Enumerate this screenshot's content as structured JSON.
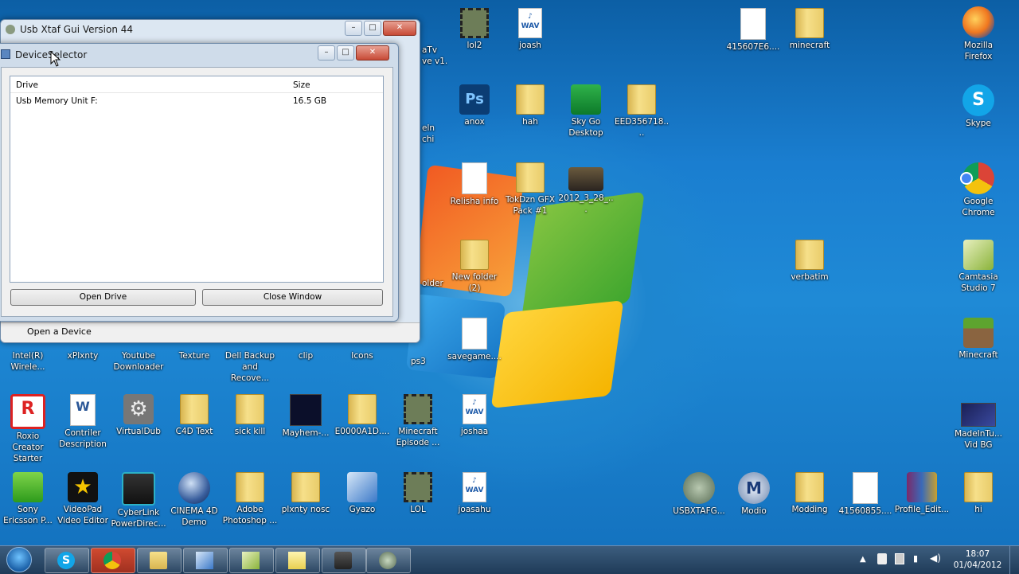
{
  "app_window": {
    "title": "Usb Xtaf Gui Version 44",
    "status": "Open a Device"
  },
  "dialog": {
    "title": "DeviceSelector",
    "columns": [
      "Drive",
      "Size"
    ],
    "rows": [
      {
        "drive": "Usb Memory Unit F:",
        "size": "16.5 GB"
      }
    ],
    "open_button": "Open Drive",
    "close_button": "Close Window"
  },
  "bg_partial_labels": {
    "a": "aTv",
    "b": "ve v1.",
    "c": "eln",
    "d": "chi",
    "e": "older",
    "f": "ps3"
  },
  "desktop_icons": [
    {
      "label": "lol2",
      "icon": "film-icon"
    },
    {
      "label": "joash",
      "icon": "wav-icon"
    },
    {
      "label": "415607E6....",
      "icon": "document-icon"
    },
    {
      "label": "minecraft",
      "icon": "folder-icon"
    },
    {
      "label": "Mozilla Firefox",
      "icon": "firefox-icon"
    },
    {
      "label": "anox",
      "icon": "psd-icon"
    },
    {
      "label": "hah",
      "icon": "folder-icon"
    },
    {
      "label": "Sky Go Desktop",
      "icon": "skygo-icon"
    },
    {
      "label": "EED356718....",
      "icon": "folder-icon"
    },
    {
      "label": "Skype",
      "icon": "skype-icon"
    },
    {
      "label": "Relisha info",
      "icon": "document-icon"
    },
    {
      "label": "TokDzn GFX Pack #1",
      "icon": "folder-icon"
    },
    {
      "label": "2012_3_28_...",
      "icon": "video-icon"
    },
    {
      "label": "Google Chrome",
      "icon": "chrome-icon"
    },
    {
      "label": "New folder (2)",
      "icon": "folder-icon"
    },
    {
      "label": "verbatim",
      "icon": "folder-icon"
    },
    {
      "label": "Camtasia Studio 7",
      "icon": "camtasia-icon"
    },
    {
      "label": "savegame....",
      "icon": "document-icon"
    },
    {
      "label": "Minecraft",
      "icon": "minecraft-icon"
    },
    {
      "label": "Intel(R) Wirele...",
      "icon": "wireless-icon"
    },
    {
      "label": "xPlxnty",
      "icon": "app-icon"
    },
    {
      "label": "Youtube Downloader",
      "icon": "youtube-icon"
    },
    {
      "label": "Texture",
      "icon": "app-icon"
    },
    {
      "label": "Dell Backup and Recove...",
      "icon": "backup-icon"
    },
    {
      "label": "clip",
      "icon": "app-icon"
    },
    {
      "label": "Icons",
      "icon": "app-icon"
    },
    {
      "label": "Roxio Creator Starter",
      "icon": "roxio-icon"
    },
    {
      "label": "Contriler Description",
      "icon": "word-icon"
    },
    {
      "label": "VirtualDub",
      "icon": "gear-icon"
    },
    {
      "label": "C4D Text",
      "icon": "folder-icon"
    },
    {
      "label": "sick kill",
      "icon": "folder-icon"
    },
    {
      "label": "Mayhem-...",
      "icon": "image-icon"
    },
    {
      "label": "E0000A1D....",
      "icon": "folder-icon"
    },
    {
      "label": "Minecraft Episode ...",
      "icon": "film-icon"
    },
    {
      "label": "joshaa",
      "icon": "wav-icon"
    },
    {
      "label": "MadeInTu... Vid BG",
      "icon": "image-icon"
    },
    {
      "label": "Sony Ericsson P...",
      "icon": "sony-icon"
    },
    {
      "label": "VideoPad Video Editor",
      "icon": "videopad-icon"
    },
    {
      "label": "CyberLink PowerDirec...",
      "icon": "cyberlink-icon"
    },
    {
      "label": "CINEMA 4D Demo",
      "icon": "cinema4d-icon"
    },
    {
      "label": "Adobe Photoshop ...",
      "icon": "folder-icon"
    },
    {
      "label": "plxnty nosc",
      "icon": "folder-icon"
    },
    {
      "label": "Gyazo",
      "icon": "gyazo-icon"
    },
    {
      "label": "LOL",
      "icon": "film-icon"
    },
    {
      "label": "joasahu",
      "icon": "wav-icon"
    },
    {
      "label": "USBXTAFG...",
      "icon": "xbox-icon"
    },
    {
      "label": "Modio",
      "icon": "modio-icon"
    },
    {
      "label": "Modding",
      "icon": "folder-icon"
    },
    {
      "label": "41560855....",
      "icon": "document-icon"
    },
    {
      "label": "Profile_Edit...",
      "icon": "winrar-icon"
    },
    {
      "label": "hi",
      "icon": "folder-icon"
    }
  ],
  "taskbar": {
    "buttons": [
      "start-orb-icon",
      "skype-icon",
      "chrome-icon",
      "explorer-icon",
      "gyazo-icon",
      "camtasia-icon",
      "folder-icon",
      "usb-icon",
      "xbox-icon"
    ],
    "clock_time": "18:07",
    "clock_date": "01/04/2012",
    "tray_icons": [
      "show-hidden-icon",
      "flag-icon",
      "battery-icon",
      "network-icon",
      "volume-icon"
    ]
  },
  "colors": {
    "desktop": "#1a7ed0",
    "taskbar": "#2a4a6b",
    "close": "#c74a36"
  }
}
